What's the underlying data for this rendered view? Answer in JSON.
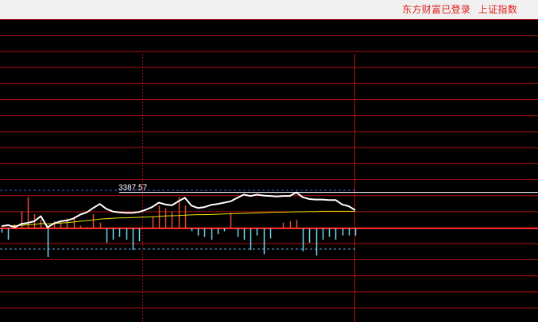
{
  "status_bar": {
    "login_status": "东方财富已登录",
    "index_name": "上证指数"
  },
  "colors": {
    "background": "#000000",
    "grid_line": "#b01010",
    "price_line": "#ffffff",
    "avg_line": "#e6e600",
    "up_bar": "#e05030",
    "down_bar": "#70d8f0",
    "ref_line": "#4060ff",
    "status_text": "#e0201a"
  },
  "chart_data": {
    "type": "line",
    "annotation": "3387.57",
    "peak_value": 3387.57,
    "price": [
      0.1,
      0.15,
      0.05,
      0.2,
      0.25,
      0.32,
      0.55,
      0.05,
      0.22,
      0.32,
      0.36,
      0.45,
      0.62,
      0.72,
      0.92,
      1.1,
      0.88,
      0.76,
      0.72,
      0.7,
      0.7,
      0.74,
      0.84,
      0.96,
      1.16,
      1.08,
      1.04,
      1.22,
      1.38,
      1.02,
      0.92,
      0.96,
      1.06,
      1.1,
      1.16,
      1.22,
      1.38,
      1.52,
      1.46,
      1.52,
      1.48,
      1.46,
      1.44,
      1.46,
      1.46,
      1.62,
      1.4,
      1.32,
      1.3,
      1.3,
      1.28,
      1.28,
      1.08,
      1.0,
      0.82
    ],
    "avg": [
      0.1,
      0.12,
      0.12,
      0.14,
      0.16,
      0.18,
      0.22,
      0.2,
      0.22,
      0.24,
      0.26,
      0.29,
      0.32,
      0.35,
      0.38,
      0.42,
      0.44,
      0.46,
      0.47,
      0.48,
      0.49,
      0.5,
      0.51,
      0.52,
      0.54,
      0.56,
      0.57,
      0.58,
      0.6,
      0.61,
      0.62,
      0.62,
      0.63,
      0.64,
      0.65,
      0.66,
      0.67,
      0.68,
      0.69,
      0.7,
      0.71,
      0.72,
      0.73,
      0.73,
      0.74,
      0.75,
      0.75,
      0.76,
      0.76,
      0.77,
      0.77,
      0.77,
      0.77,
      0.77,
      0.77
    ],
    "breadth": [
      -0.3,
      -0.8,
      0.3,
      1.2,
      2.2,
      1.0,
      0.6,
      -2.0,
      0.5,
      0.5,
      0.7,
      0.8,
      0.2,
      0.1,
      1.0,
      0.4,
      -1.0,
      -0.8,
      -0.6,
      -0.8,
      -1.5,
      -0.9,
      0.0,
      0.8,
      1.6,
      1.4,
      1.2,
      2.2,
      1.6,
      -0.2,
      -0.5,
      -0.6,
      -0.8,
      -0.4,
      -0.2,
      1.1,
      -0.6,
      -0.8,
      -1.5,
      -0.5,
      -1.8,
      -0.7,
      0.0,
      0.4,
      0.5,
      0.6,
      -1.6,
      -1.0,
      -1.9,
      -0.8,
      -0.6,
      -0.8,
      -0.5,
      -0.5,
      -0.5
    ]
  }
}
